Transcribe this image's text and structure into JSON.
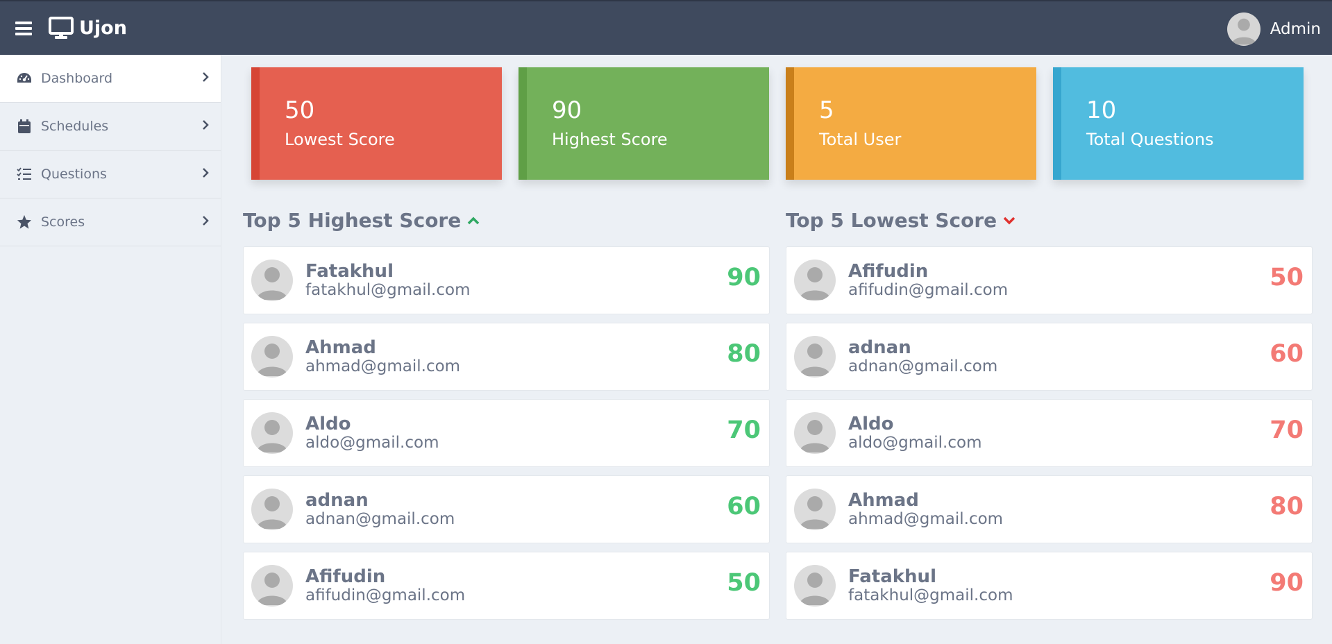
{
  "header": {
    "brand": "Ujon",
    "user": "Admin"
  },
  "sidebar": {
    "items": [
      {
        "label": "Dashboard",
        "icon": "dashboard-icon",
        "active": true
      },
      {
        "label": "Schedules",
        "icon": "calendar-icon"
      },
      {
        "label": "Questions",
        "icon": "tasks-icon"
      },
      {
        "label": "Scores",
        "icon": "star-icon"
      }
    ]
  },
  "stats": [
    {
      "value": "50",
      "label": "Lowest Score",
      "color": "#e56050",
      "accent": "#d64535"
    },
    {
      "value": "90",
      "label": "Highest Score",
      "color": "#73b15a",
      "accent": "#5f9f46"
    },
    {
      "value": "5",
      "label": "Total User",
      "color": "#f4ab42",
      "accent": "#c97f1a"
    },
    {
      "value": "10",
      "label": "Total Questions",
      "color": "#51bcdf",
      "accent": "#36a6cf"
    }
  ],
  "highest": {
    "title": "Top 5 Highest Score",
    "score_color": "#4cc777",
    "rows": [
      {
        "name": "Fatakhul",
        "email": "fatakhul@gmail.com",
        "score": "90"
      },
      {
        "name": "Ahmad",
        "email": "ahmad@gmail.com",
        "score": "80"
      },
      {
        "name": "Aldo",
        "email": "aldo@gmail.com",
        "score": "70"
      },
      {
        "name": "adnan",
        "email": "adnan@gmail.com",
        "score": "60"
      },
      {
        "name": "Afifudin",
        "email": "afifudin@gmail.com",
        "score": "50"
      }
    ]
  },
  "lowest": {
    "title": "Top 5 Lowest Score",
    "score_color": "#f37a75",
    "rows": [
      {
        "name": "Afifudin",
        "email": "afifudin@gmail.com",
        "score": "50"
      },
      {
        "name": "adnan",
        "email": "adnan@gmail.com",
        "score": "60"
      },
      {
        "name": "Aldo",
        "email": "aldo@gmail.com",
        "score": "70"
      },
      {
        "name": "Ahmad",
        "email": "ahmad@gmail.com",
        "score": "80"
      },
      {
        "name": "Fatakhul",
        "email": "fatakhul@gmail.com",
        "score": "90"
      }
    ]
  }
}
